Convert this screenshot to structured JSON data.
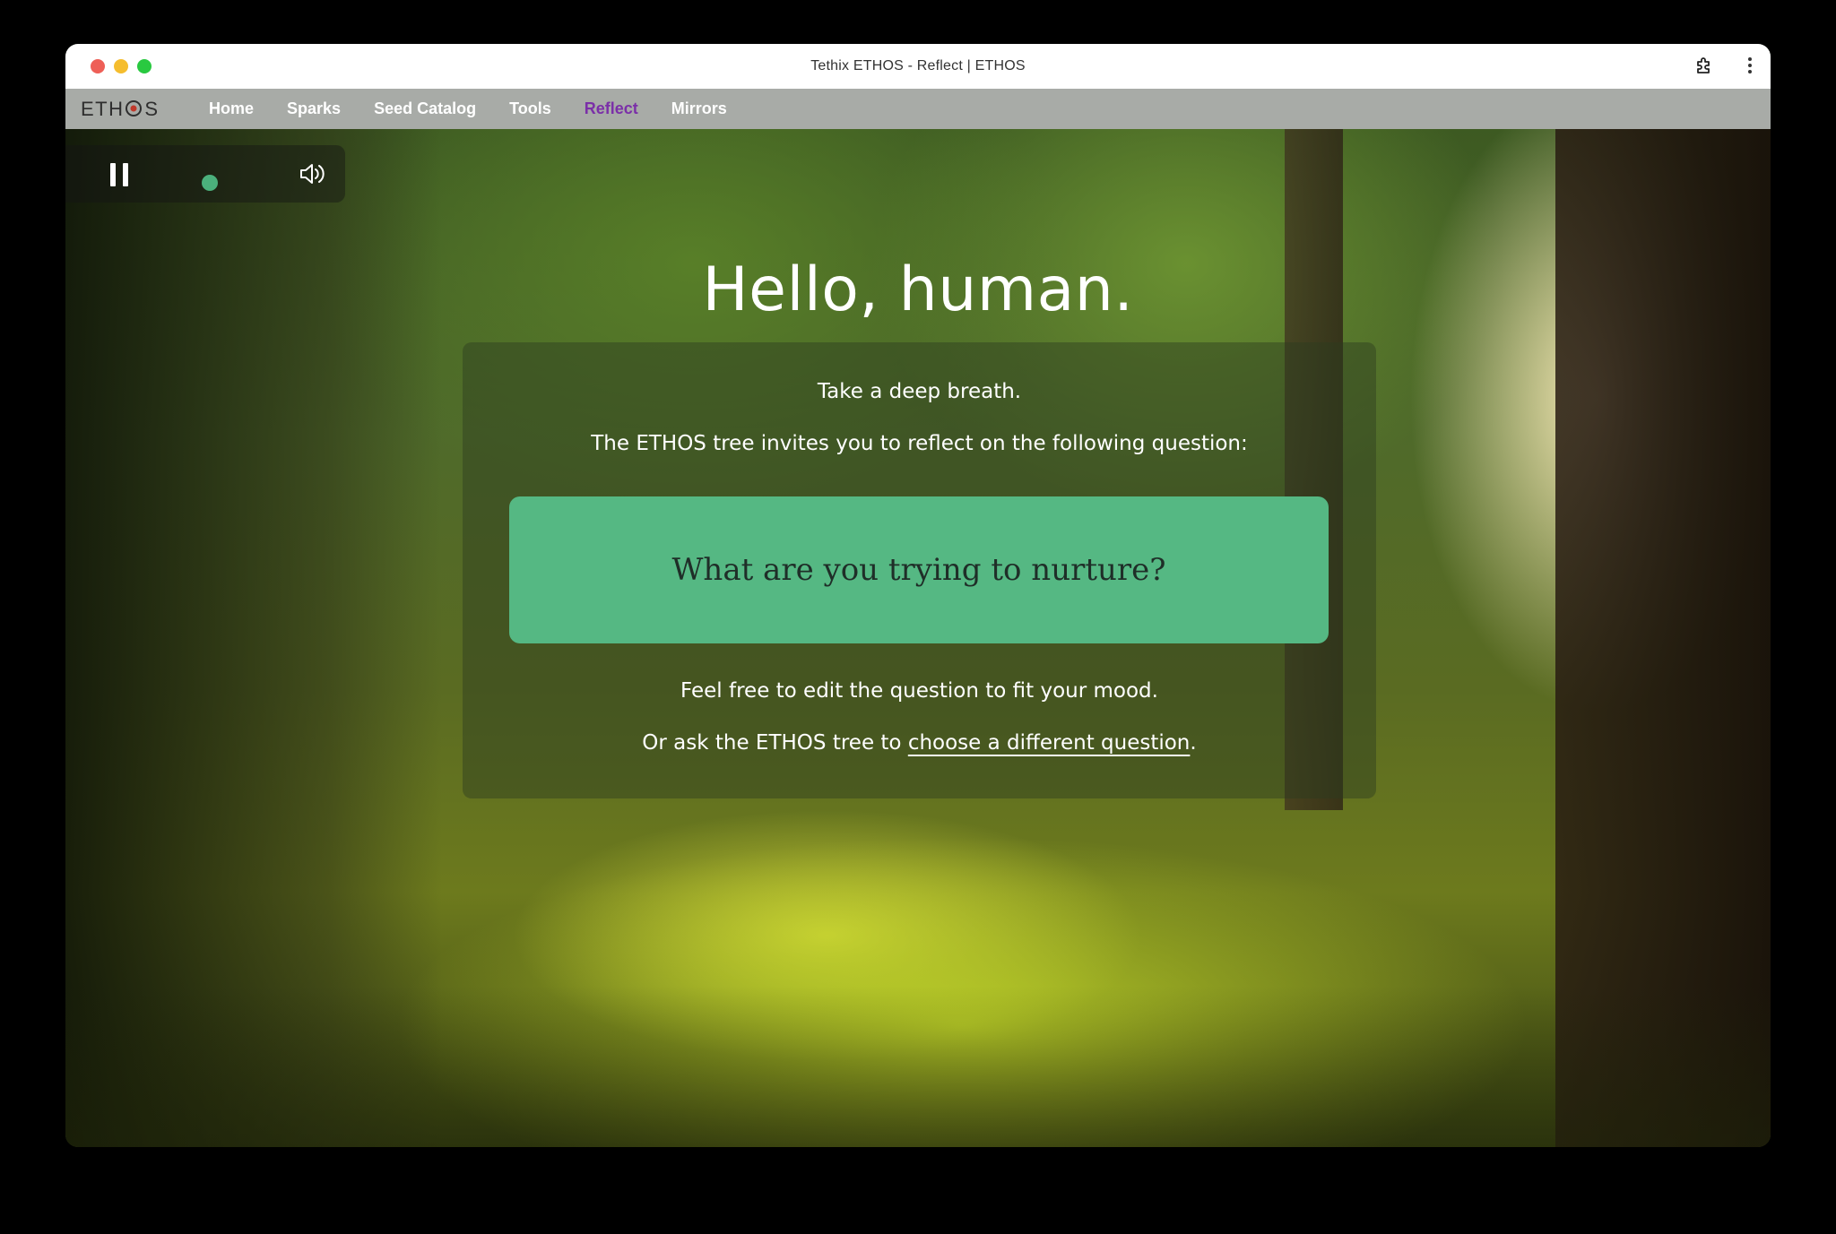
{
  "window": {
    "title": "Tethix ETHOS - Reflect | ETHOS",
    "traffic_colors": [
      "#ee5f57",
      "#f5bd2e",
      "#29c940"
    ]
  },
  "nav": {
    "logo": {
      "before": "ETH",
      "after": "S"
    },
    "items": [
      {
        "label": "Home",
        "active": false
      },
      {
        "label": "Sparks",
        "active": false
      },
      {
        "label": "Seed Catalog",
        "active": false
      },
      {
        "label": "Tools",
        "active": false
      },
      {
        "label": "Reflect",
        "active": true
      },
      {
        "label": "Mirrors",
        "active": false
      }
    ],
    "active_color": "#7b2fa8"
  },
  "player": {
    "pause_icon": "pause-icon",
    "volume_icon": "volume-icon",
    "indicator_color": "#4bb07c"
  },
  "main": {
    "greeting": "Hello, human.",
    "intro_line1": "Take a deep breath.",
    "intro_line2": "The ETHOS tree invites you to reflect on the following question:",
    "question": "What are you trying to nurture?",
    "question_bg": "#55b883",
    "hint_line": "Feel free to edit the question to fit your mood.",
    "ask_prefix": "Or ask the ETHOS tree to ",
    "ask_link": "choose a different question",
    "ask_suffix": "."
  }
}
